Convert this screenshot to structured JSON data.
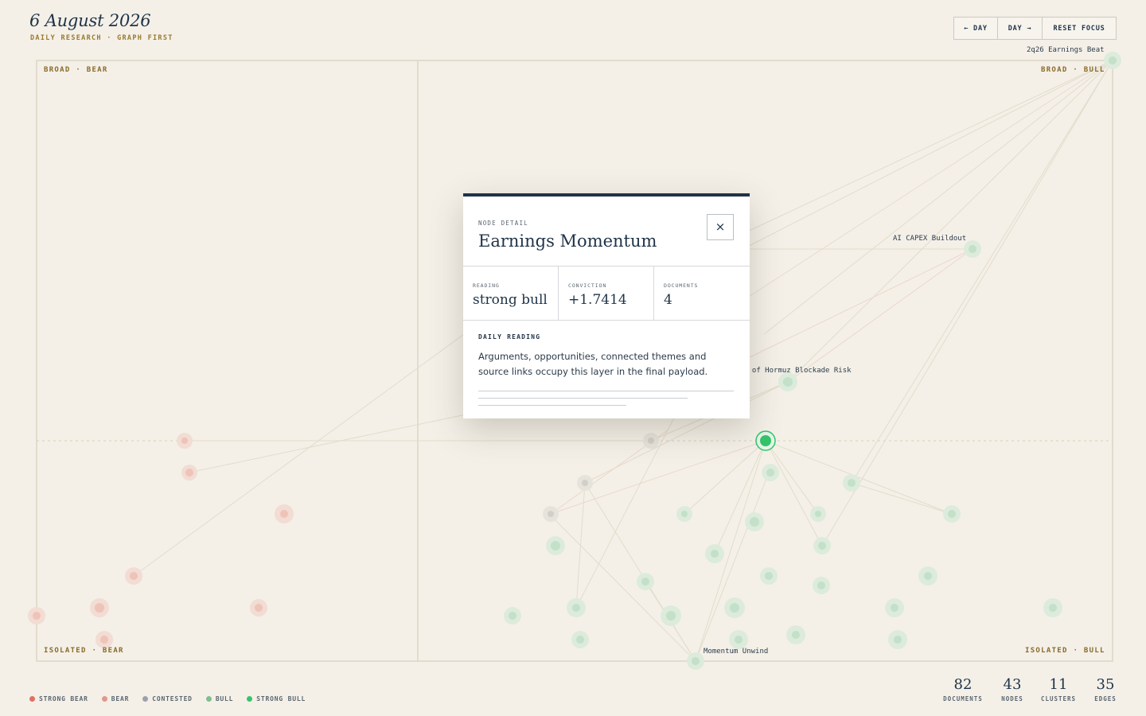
{
  "header": {
    "date": "6 August 2026",
    "subtitle": "DAILY RESEARCH · GRAPH FIRST"
  },
  "nav": {
    "prev_day": "← DAY",
    "next_day": "DAY →",
    "reset_focus": "RESET FOCUS"
  },
  "quadrants": {
    "top_left": "BROAD · BEAR",
    "top_right": "BROAD · BULL",
    "bottom_left": "ISOLATED · BEAR",
    "bottom_right": "ISOLATED · BULL"
  },
  "node_labels": {
    "earnings_beat": "2q26 Earnings Beat",
    "ai_capex": "AI CAPEX Buildout",
    "hormuz": "Strait of Hormuz Blockade Risk",
    "momentum_unwind": "Momentum Unwind"
  },
  "legend": [
    {
      "label": "STRONG BEAR",
      "color": "#e0705f"
    },
    {
      "label": "BEAR",
      "color": "#e0988a"
    },
    {
      "label": "CONTESTED",
      "color": "#9aa1ad"
    },
    {
      "label": "BULL",
      "color": "#7fbf8e"
    },
    {
      "label": "STRONG BULL",
      "color": "#35c46a"
    }
  ],
  "stats": {
    "documents": {
      "value": "82",
      "label": "DOCUMENTS"
    },
    "nodes": {
      "value": "43",
      "label": "NODES"
    },
    "clusters": {
      "value": "11",
      "label": "CLUSTERS"
    },
    "edges": {
      "value": "35",
      "label": "EDGES"
    }
  },
  "modal": {
    "kicker": "NODE DETAIL",
    "title": "Earnings Momentum",
    "close_icon": "×",
    "reading_label": "READING",
    "reading_value": "strong bull",
    "conviction_label": "CONVICTION",
    "conviction_value": "+1.7414",
    "documents_label": "DOCUMENTS",
    "documents_value": "4",
    "daily_reading_head": "DAILY READING",
    "daily_reading_text": "Arguments, opportunities, connected themes and source links occupy this layer in the final payload."
  },
  "colors": {
    "background": "#f4f0e8",
    "ink": "#1f3347",
    "gold": "#9a7a2e",
    "strong_bull": "#35c46a",
    "bull": "#7fbf8e",
    "bear": "#e0988a",
    "strong_bear": "#e0705f"
  }
}
